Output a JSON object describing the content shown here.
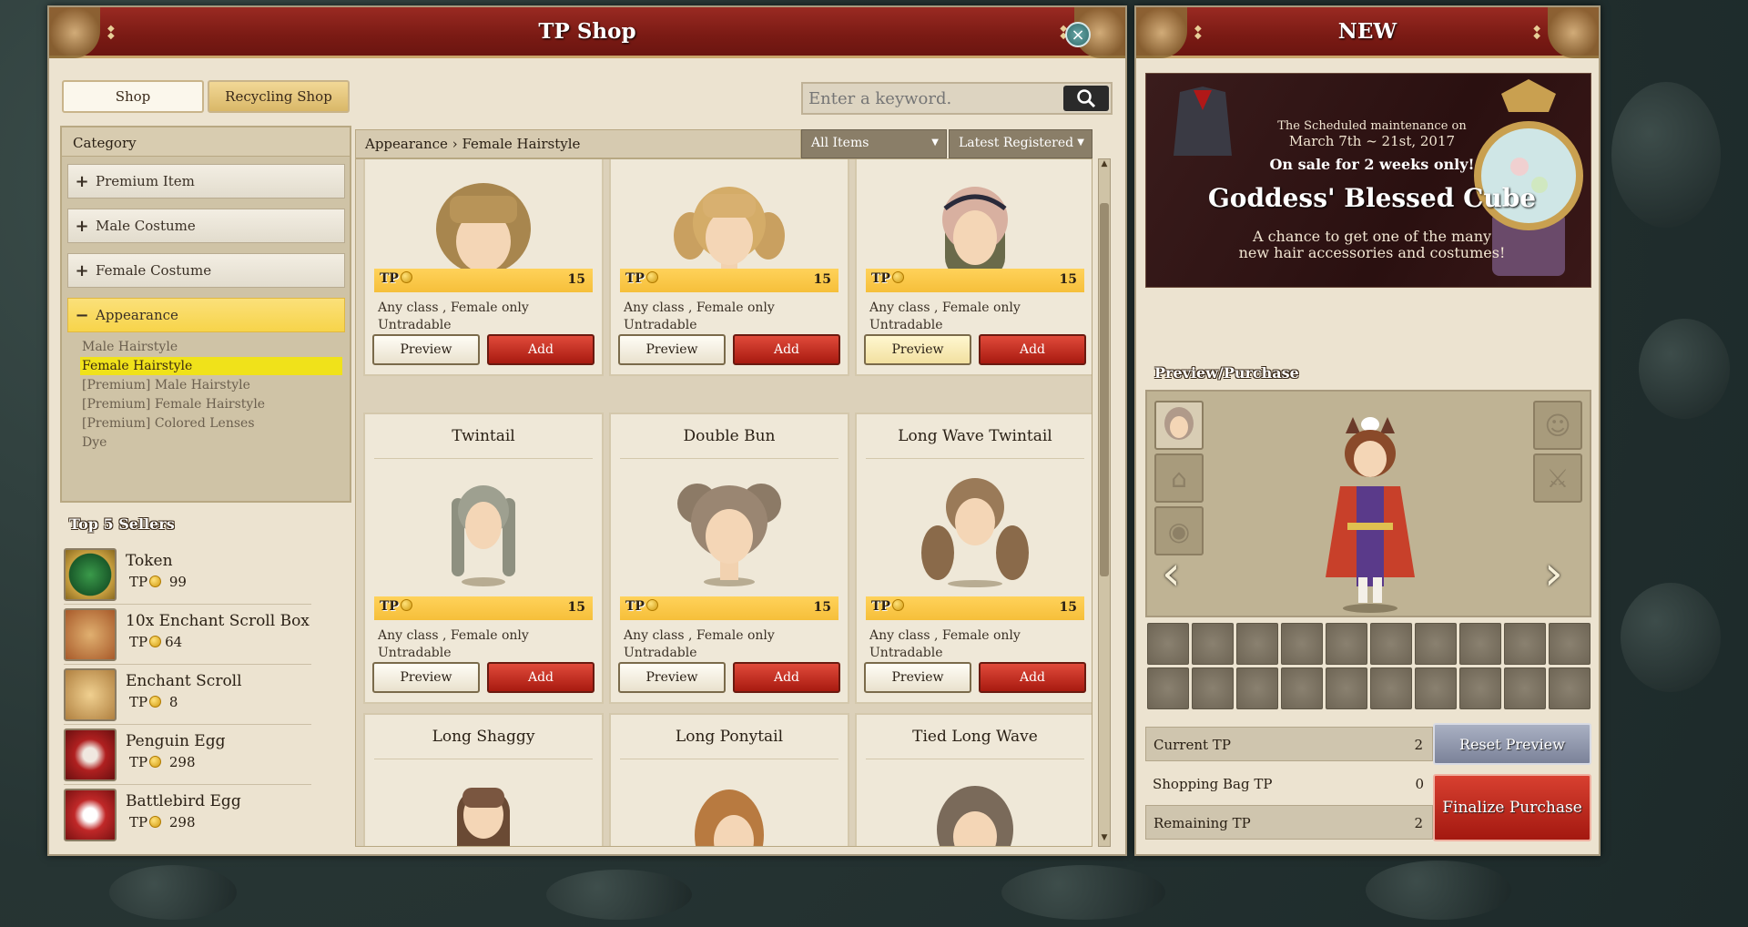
{
  "shop_window": {
    "title": "TP Shop",
    "tabs": [
      {
        "label": "Shop"
      },
      {
        "label": "Recycling Shop"
      }
    ],
    "search": {
      "placeholder": "Enter a keyword.",
      "value": ""
    },
    "category": {
      "header": "Category",
      "items": [
        {
          "label": "Premium Item",
          "toggle": "+"
        },
        {
          "label": "Male Costume",
          "toggle": "+"
        },
        {
          "label": "Female Costume",
          "toggle": "+"
        },
        {
          "label": "Appearance",
          "toggle": "−"
        }
      ],
      "subitems": [
        {
          "label": "Male Hairstyle"
        },
        {
          "label": "Female Hairstyle"
        },
        {
          "label": "[Premium] Male Hairstyle"
        },
        {
          "label": "[Premium] Female Hairstyle"
        },
        {
          "label": "[Premium] Colored Lenses"
        },
        {
          "label": "Dye"
        }
      ]
    },
    "top5": {
      "title": "Top 5 Sellers",
      "items": [
        {
          "name": "Token",
          "price": "99"
        },
        {
          "name": "10x Enchant Scroll Box",
          "price": "64"
        },
        {
          "name": "Enchant Scroll",
          "price": "8"
        },
        {
          "name": "Penguin Egg",
          "price": "298"
        },
        {
          "name": "Battlebird Egg",
          "price": "298"
        }
      ],
      "currency": "TP"
    },
    "breadcrumb": "Appearance › Female Hairstyle",
    "filter": {
      "value": "All Items"
    },
    "sort": {
      "value": "Latest Registered"
    },
    "products": [
      {
        "name": "",
        "currency": "TP",
        "price": "15",
        "desc1": "Any class , Female only",
        "desc2": "Untradable",
        "preview": "Preview",
        "add": "Add"
      },
      {
        "name": "",
        "currency": "TP",
        "price": "15",
        "desc1": "Any class , Female only",
        "desc2": "Untradable",
        "preview": "Preview",
        "add": "Add"
      },
      {
        "name": "",
        "currency": "TP",
        "price": "15",
        "desc1": "Any class , Female only",
        "desc2": "Untradable",
        "preview": "Preview",
        "add": "Add"
      },
      {
        "name": "Twintail",
        "currency": "TP",
        "price": "15",
        "desc1": "Any class , Female only",
        "desc2": "Untradable",
        "preview": "Preview",
        "add": "Add"
      },
      {
        "name": "Double Bun",
        "currency": "TP",
        "price": "15",
        "desc1": "Any class , Female only",
        "desc2": "Untradable",
        "preview": "Preview",
        "add": "Add"
      },
      {
        "name": "Long Wave Twintail",
        "currency": "TP",
        "price": "15",
        "desc1": "Any class , Female only",
        "desc2": "Untradable",
        "preview": "Preview",
        "add": "Add"
      },
      {
        "name": "Long Shaggy"
      },
      {
        "name": "Long Ponytail"
      },
      {
        "name": "Tied Long Wave"
      }
    ]
  },
  "new_window": {
    "title": "NEW",
    "banner": {
      "line1": "The Scheduled maintenance on",
      "line2": "March  7th ~ 21st, 2017",
      "line3": "On sale for 2 weeks only!",
      "headline": "Goddess' Blessed Cube",
      "body1": "A chance to get one of the many",
      "body2": "new hair accessories and costumes!"
    },
    "preview_title": "Preview/Purchase",
    "tp": {
      "current_label": "Current TP",
      "current_value": "2",
      "bag_label": "Shopping Bag TP",
      "bag_value": "0",
      "remaining_label": "Remaining TP",
      "remaining_value": "2"
    },
    "reset_label": "Reset Preview",
    "finalize_label": "Finalize Purchase",
    "icons": {
      "close": "close-icon",
      "search": "search-icon",
      "prev": "chevron-left-icon",
      "next": "chevron-right-icon"
    }
  }
}
